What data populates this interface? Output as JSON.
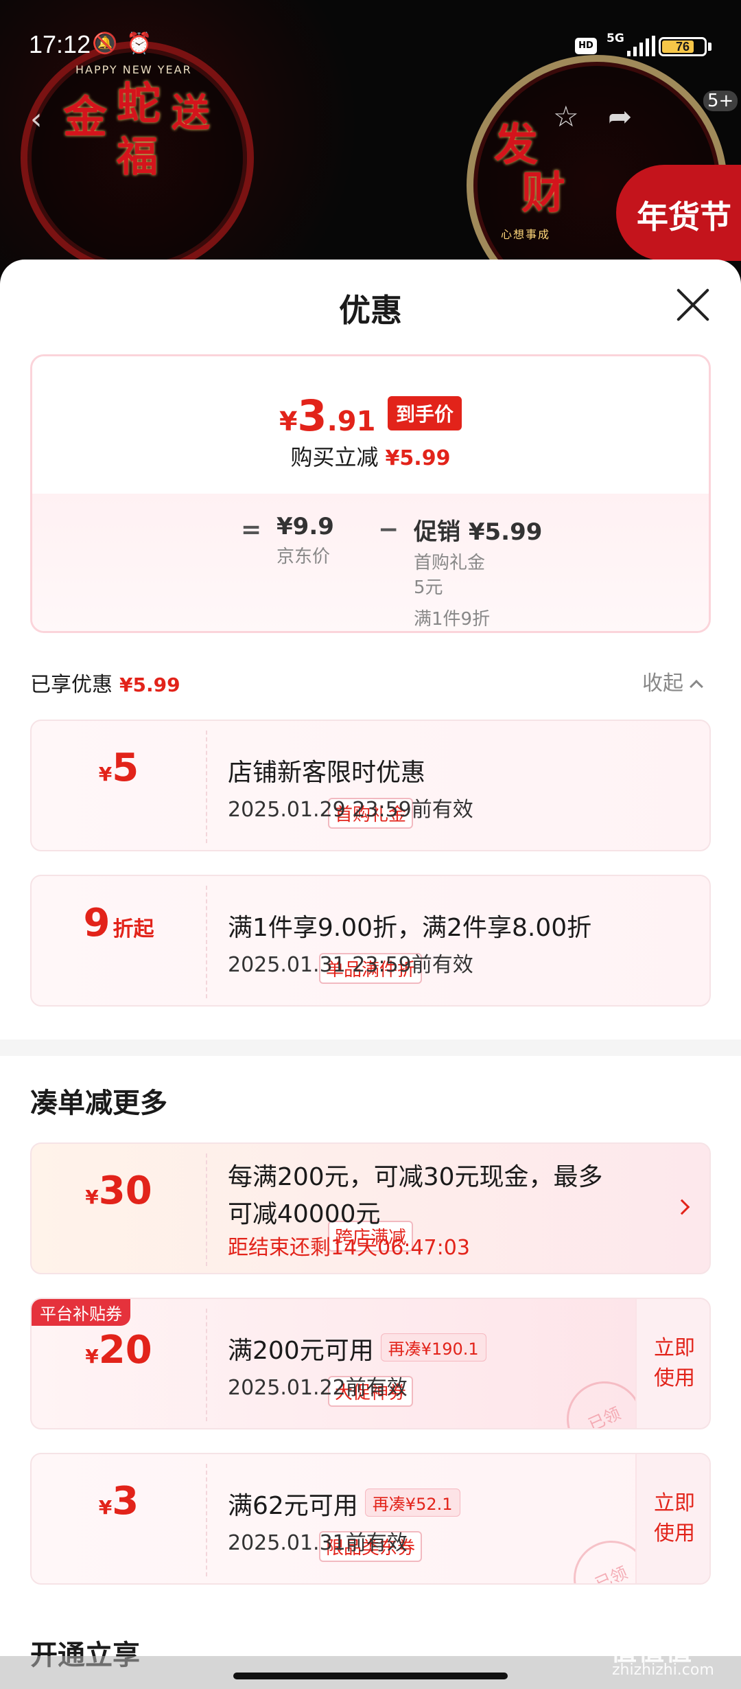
{
  "status_bar": {
    "time": "17:12",
    "network": "5G",
    "hd": "HD",
    "battery": "76",
    "battery_percent": 76
  },
  "banner": {
    "deco_left_text": "HAPPY NEW YEAR",
    "deco_left_chars": [
      "金",
      "蛇",
      "送",
      "福"
    ],
    "deco_right_chars": [
      "发",
      "财"
    ],
    "deco_right_caption": "心想事成",
    "cart_badge": "5+",
    "festival_tag": "年货节"
  },
  "sheet": {
    "title": "优惠"
  },
  "summary": {
    "yen": "¥",
    "price_int": "3",
    "price_dec": ".91",
    "price_tag": "到手价",
    "reduce_label": "购买立减",
    "reduce_value": "¥5.99",
    "eq": "=",
    "minus": "−",
    "jd_price": "¥9.9",
    "jd_price_label": "京东价",
    "promo_label": "促销 ¥5.99",
    "promo_items": [
      "首购礼金",
      "5元",
      "满1件9折"
    ]
  },
  "enjoyed": {
    "label": "已享优惠",
    "value": "¥5.99",
    "collapse": "收起"
  },
  "coupons_enjoyed": [
    {
      "symbol": "¥",
      "amount": "5",
      "unit": "",
      "type": "首购礼金",
      "title": "店铺新客限时优惠",
      "subline": "2025.01.29 23:59前有效"
    },
    {
      "symbol": "",
      "amount": "9",
      "unit": "折起",
      "type": "单品满件折",
      "title": "满1件享9.00折，满2件享8.00折",
      "subline": "2025.01.31 23:59前有效"
    }
  ],
  "more_section": {
    "title": "凑单减更多"
  },
  "coupons_more": [
    {
      "symbol": "¥",
      "amount": "30",
      "type": "跨店满减",
      "title_line1": "每满200元，可减30元现金，最多",
      "title_line2": "可减40000元",
      "countdown": "距结束还剩14天06:47:03"
    },
    {
      "badge": "平台补贴券",
      "symbol": "¥",
      "amount": "20",
      "type": "大促神券",
      "title": "满200元可用",
      "extra": "再凑¥190.1",
      "subline": "2025.01.22前有效",
      "use": "立即使用",
      "stamp": "已领"
    },
    {
      "symbol": "¥",
      "amount": "3",
      "type": "限品类东券",
      "title": "满62元可用",
      "extra": "再凑¥52.1",
      "subline": "2025.01.31前有效",
      "use": "立即使用",
      "stamp": "已领"
    }
  ],
  "next_section": {
    "title": "开通立享"
  },
  "watermark": {
    "main": "值值值",
    "sub": "zhizhizhi.com"
  },
  "colors": {
    "accent": "#e2231a",
    "sheet_bg": "#ffffff",
    "banner_bg": "#080808"
  }
}
